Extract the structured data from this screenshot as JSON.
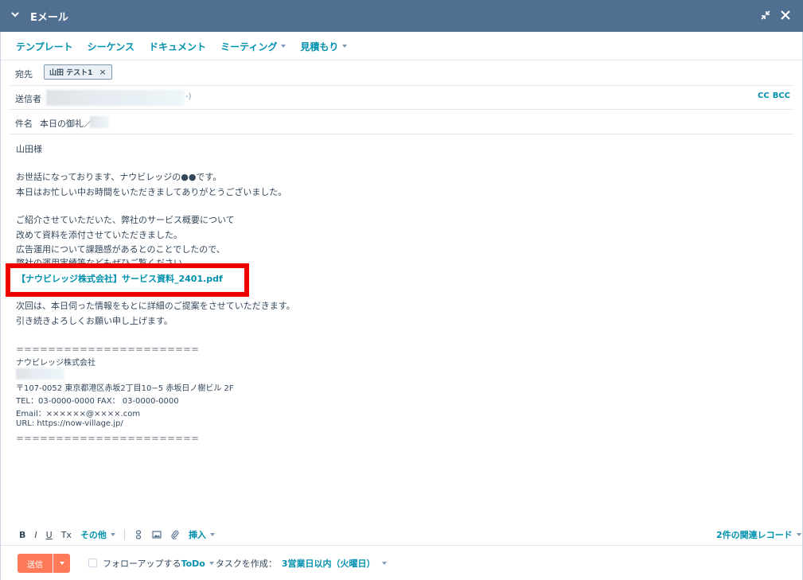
{
  "window": {
    "title": "Eメール"
  },
  "toolbar": {
    "items": [
      {
        "label": "テンプレート",
        "dropdown": false
      },
      {
        "label": "シーケンス",
        "dropdown": false
      },
      {
        "label": "ドキュメント",
        "dropdown": false
      },
      {
        "label": "ミーティング",
        "dropdown": true
      },
      {
        "label": "見積もり",
        "dropdown": true
      }
    ]
  },
  "to": {
    "label": "宛先",
    "recipient": "山田 テスト1",
    "remove_symbol": "×"
  },
  "from": {
    "label": "送信者",
    "tail": "-)"
  },
  "cc_bcc": {
    "cc": "CC",
    "bcc": "BCC"
  },
  "subject": {
    "label": "件名",
    "value": "本日の御礼／"
  },
  "body": {
    "greeting": "山田様",
    "p1": [
      "お世話になっております、ナウビレッジの●●です。",
      "本日はお忙しい中お時間をいただきましてありがとうございました。"
    ],
    "p2": [
      "ご紹介させていただいた、弊社のサービス概要について",
      "改めて資料を添付させていただきました。",
      "広告運用について課題感があるとのことでしたので、",
      "弊社の運用実績等などもぜひご覧ください。"
    ],
    "attachment": "【ナウビレッジ株式会社】サービス資料_2401.pdf",
    "p3": [
      "次回は、本日伺った情報をもとに詳細のご提案をさせていただきます。",
      "引き続きよろしくお願い申し上げます。"
    ],
    "signature": {
      "rule": "＝＝＝＝＝＝＝＝＝＝＝＝＝＝＝＝＝＝＝＝＝＝＝",
      "company": "ナウビレッジ株式会社",
      "address": "〒107-0052 東京都港区赤坂2丁目10−5 赤坂日ノ樹ビル 2F",
      "tel": "TEL：03-0000-0000 FAX： 03-0000-0000",
      "email": "Email：××××××@××××.com",
      "url": "URL: https://now-village.jp/"
    }
  },
  "format_bar": {
    "bold": "B",
    "italic": "I",
    "underline": "U",
    "clear": "Tx",
    "more": "その他",
    "insert": "挿入"
  },
  "related_records": "2件の関連レコード",
  "footer": {
    "send": "送信",
    "followup_text": "フォローアップする",
    "todo": "ToDo",
    "task_text": "タスクを作成：",
    "due": "3営業日以内（火曜日）"
  },
  "colors": {
    "header": "#516f90",
    "accent": "#0091ae",
    "send": "#ff7a59",
    "highlight": "#ee0000"
  }
}
